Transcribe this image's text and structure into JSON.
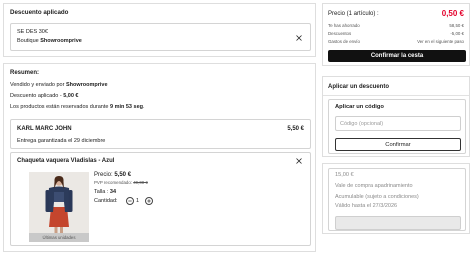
{
  "applied_discount": {
    "title": "Descuento aplicado",
    "code": "SE DES 30€",
    "boutique_prefix": "Boutique ",
    "boutique_name": "Showroomprive"
  },
  "summary": {
    "title": "Resumen:",
    "sold_by_prefix": "Vendido y enviado por ",
    "sold_by": "Showroomprive",
    "discount_prefix": "Descuento aplicado - ",
    "discount_value": "5,00 €",
    "reserved_prefix": "Los productos están reservados durante ",
    "reserved_time": "9 min 53 seg",
    "reserved_suffix": ".",
    "brand_group": {
      "name": "KARL MARC JOHN",
      "subtotal": "5,50 €",
      "delivery": "Entrega garantizada el 29 diciembre"
    },
    "product": {
      "name": "Chaqueta vaquera Vladislas - Azul",
      "image_badge": "Últimas unidades",
      "price_label": "Precio: ",
      "price": "5,50 €",
      "rrp_label": "PVP recomendado: ",
      "rrp": "49,00 €",
      "size_label": "Talla : ",
      "size": "34",
      "quantity_label": "Cantidad:",
      "quantity": "1"
    }
  },
  "order_total": {
    "price_label": "Precio (1 artículo) :",
    "price": "0,50 €",
    "rows": [
      {
        "label": "Te has ahorrado",
        "value": "58,50 €"
      },
      {
        "label": "Descuentos",
        "value": "-5,00 €"
      },
      {
        "label": "Gastos de envío",
        "value": "Ver en el siguiente paso"
      }
    ],
    "confirm_button": "Confirmar la cesta"
  },
  "discount_panel": {
    "title": "Aplicar un descuento",
    "code_title": "Aplicar un código",
    "code_placeholder": "Código (opcional)",
    "confirm_button": "Confirmar"
  },
  "voucher": {
    "amount": "15,00 €",
    "name": "Vale de compra apadrinamiento",
    "condition": "Acumulable (sujeto a condiciones)",
    "validity": "Válido hasta el 27/3/2026"
  },
  "icons": {
    "remove": "close-icon",
    "decrease": "minus-icon",
    "increase": "plus-icon"
  },
  "colors": {
    "accent": "#e4002b",
    "dark": "#111111",
    "text": "#222222",
    "muted": "#8a8a8a",
    "border": "#dedede"
  }
}
